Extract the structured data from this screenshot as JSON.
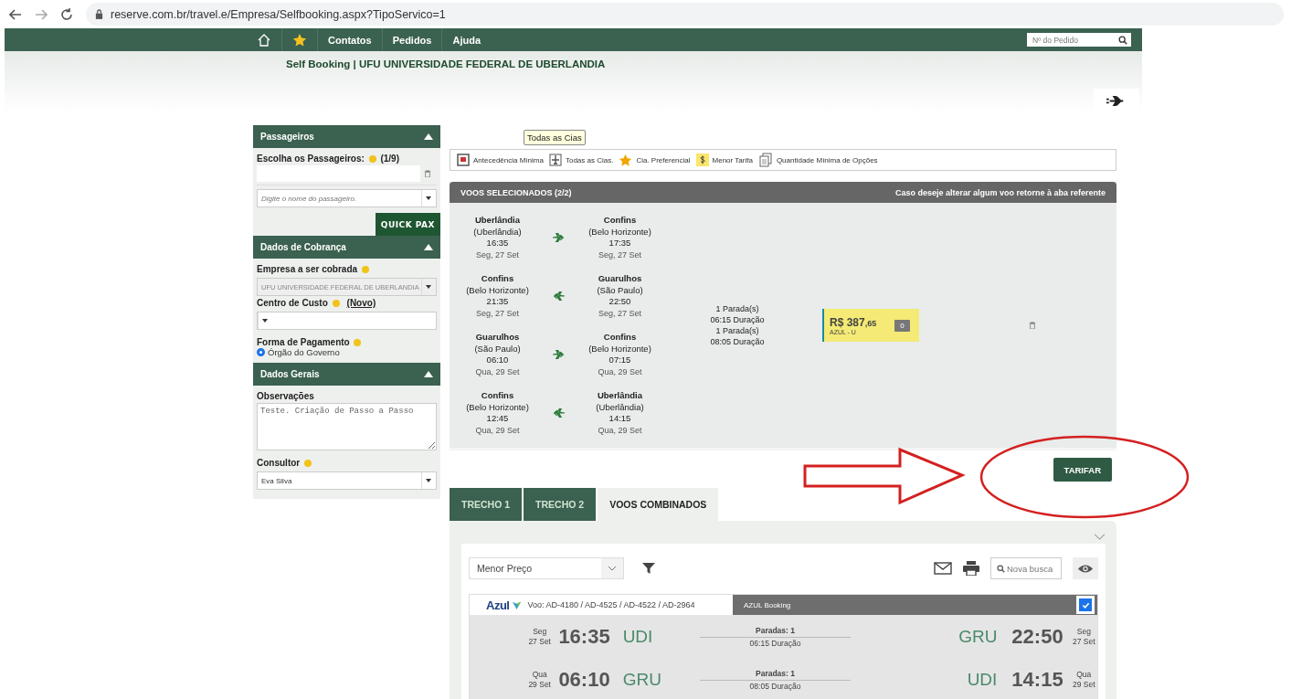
{
  "browser": {
    "url": "reserve.com.br/travel.e/Empresa/Selfbooking.aspx?TipoServico=1"
  },
  "nav": {
    "items": [
      {
        "kind": "home"
      },
      {
        "kind": "star"
      },
      {
        "kind": "link",
        "label": "Contatos"
      },
      {
        "kind": "link",
        "label": "Pedidos"
      },
      {
        "kind": "link",
        "label": "Ajuda"
      }
    ],
    "search_placeholder": "Nº do Pedido"
  },
  "page_title": "Self Booking | UFU UNIVERSIDADE FEDERAL DE UBERLANDIA",
  "passengers": {
    "title": "Passageiros",
    "expanded": true,
    "label": "Escolha os Passageiros:",
    "count": "(1/9)",
    "placeholder": "Digite o nome do passageiro.",
    "button": "QUICK PAX"
  },
  "billing": {
    "title": "Dados de Cobrança",
    "expanded": true,
    "company_label": "Empresa a ser cobrada",
    "company_value": "UFU UNIVERSIDADE FEDERAL DE UBERLANDIA",
    "company_disabled": true,
    "cost_label": "Centro de Custo",
    "new_link": "(Novo)",
    "payment_label": "Forma de Pagamento",
    "payment_options": [
      {
        "label": "Órgão do Governo",
        "selected": true
      }
    ]
  },
  "general": {
    "title": "Dados Gerais",
    "expanded": true,
    "notes_label": "Observações",
    "notes_value": "Teste. Criação de Passo a Passo",
    "consultant_label": "Consultor",
    "consultant_value": "Eva Silva"
  },
  "filters": {
    "tooltip": "Todas as Cias",
    "items": [
      {
        "kind": "calendar",
        "label": "Antecedência Mínima"
      },
      {
        "kind": "plane",
        "label": "Todas as Cias."
      },
      {
        "kind": "star",
        "label": "Cia. Preferencial"
      },
      {
        "kind": "dollar",
        "label": "Menor Tarifa"
      },
      {
        "kind": "docs",
        "label": "Quantidade Mínima de Opções"
      }
    ]
  },
  "selected_flights": {
    "title": "VOOS SELECIONADOS (2/2)",
    "note": "Caso deseje alterar algum voo retorne à aba referente",
    "legs": [
      {
        "from": "Uberlândia",
        "from_city": "(Uberlândia)",
        "dep": "16:35",
        "dep_date": "Seg, 27 Set",
        "return": false,
        "to": "Confins",
        "to_city": "(Belo Horizonte)",
        "arr": "17:35",
        "arr_date": "Seg, 27 Set"
      },
      {
        "from": "Confins",
        "from_city": "(Belo Horizonte)",
        "dep": "21:35",
        "dep_date": "Seg, 27 Set",
        "return": true,
        "to": "Guarulhos",
        "to_city": "(São Paulo)",
        "arr": "22:50",
        "arr_date": "Seg, 27 Set"
      },
      {
        "from": "Guarulhos",
        "from_city": "(São Paulo)",
        "dep": "06:10",
        "dep_date": "Qua, 29 Set",
        "return": false,
        "to": "Confins",
        "to_city": "(Belo Horizonte)",
        "arr": "07:15",
        "arr_date": "Qua, 29 Set"
      },
      {
        "from": "Confins",
        "from_city": "(Belo Horizonte)",
        "dep": "12:45",
        "dep_date": "Qua, 29 Set",
        "return": true,
        "to": "Uberlândia",
        "to_city": "(Uberlândia)",
        "arr": "14:15",
        "arr_date": "Qua, 29 Set"
      }
    ],
    "summary": [
      "1 Parada(s)",
      "06:15 Duração",
      "1 Parada(s)",
      "08:05 Duração"
    ],
    "fare": {
      "price": "R$ 387",
      "cents": ",65",
      "airline": "AZUL - U",
      "bags": "0"
    }
  },
  "price_button": "TARIFAR",
  "tabs": [
    {
      "label": "TRECHO 1",
      "selected": false
    },
    {
      "label": "TRECHO 2",
      "selected": false
    },
    {
      "label": "VOOS COMBINADOS",
      "selected": true
    }
  ],
  "results": {
    "sort": "Menor Preço",
    "search_placeholder": "Nova busca",
    "card": {
      "airline": "Azul",
      "flights": "Voo: AD-4180 / AD-4525 / AD-4522 / AD-2964",
      "provider": "AZUL Booking",
      "checked": true,
      "rows": [
        {
          "dep_day": "Seg",
          "dep_date": "27 Set",
          "dep_time": "16:35",
          "from": "UDI",
          "stops": "Paradas: 1",
          "duration": "06:15 Duração",
          "to": "GRU",
          "arr_time": "22:50",
          "arr_day": "Seg",
          "arr_date": "27 Set"
        },
        {
          "dep_day": "Qua",
          "dep_date": "29 Set",
          "dep_time": "06:10",
          "from": "GRU",
          "stops": "Paradas: 1",
          "duration": "08:05 Duração",
          "to": "UDI",
          "arr_time": "14:15",
          "arr_day": "Qua",
          "arr_date": "29 Set"
        }
      ]
    }
  }
}
